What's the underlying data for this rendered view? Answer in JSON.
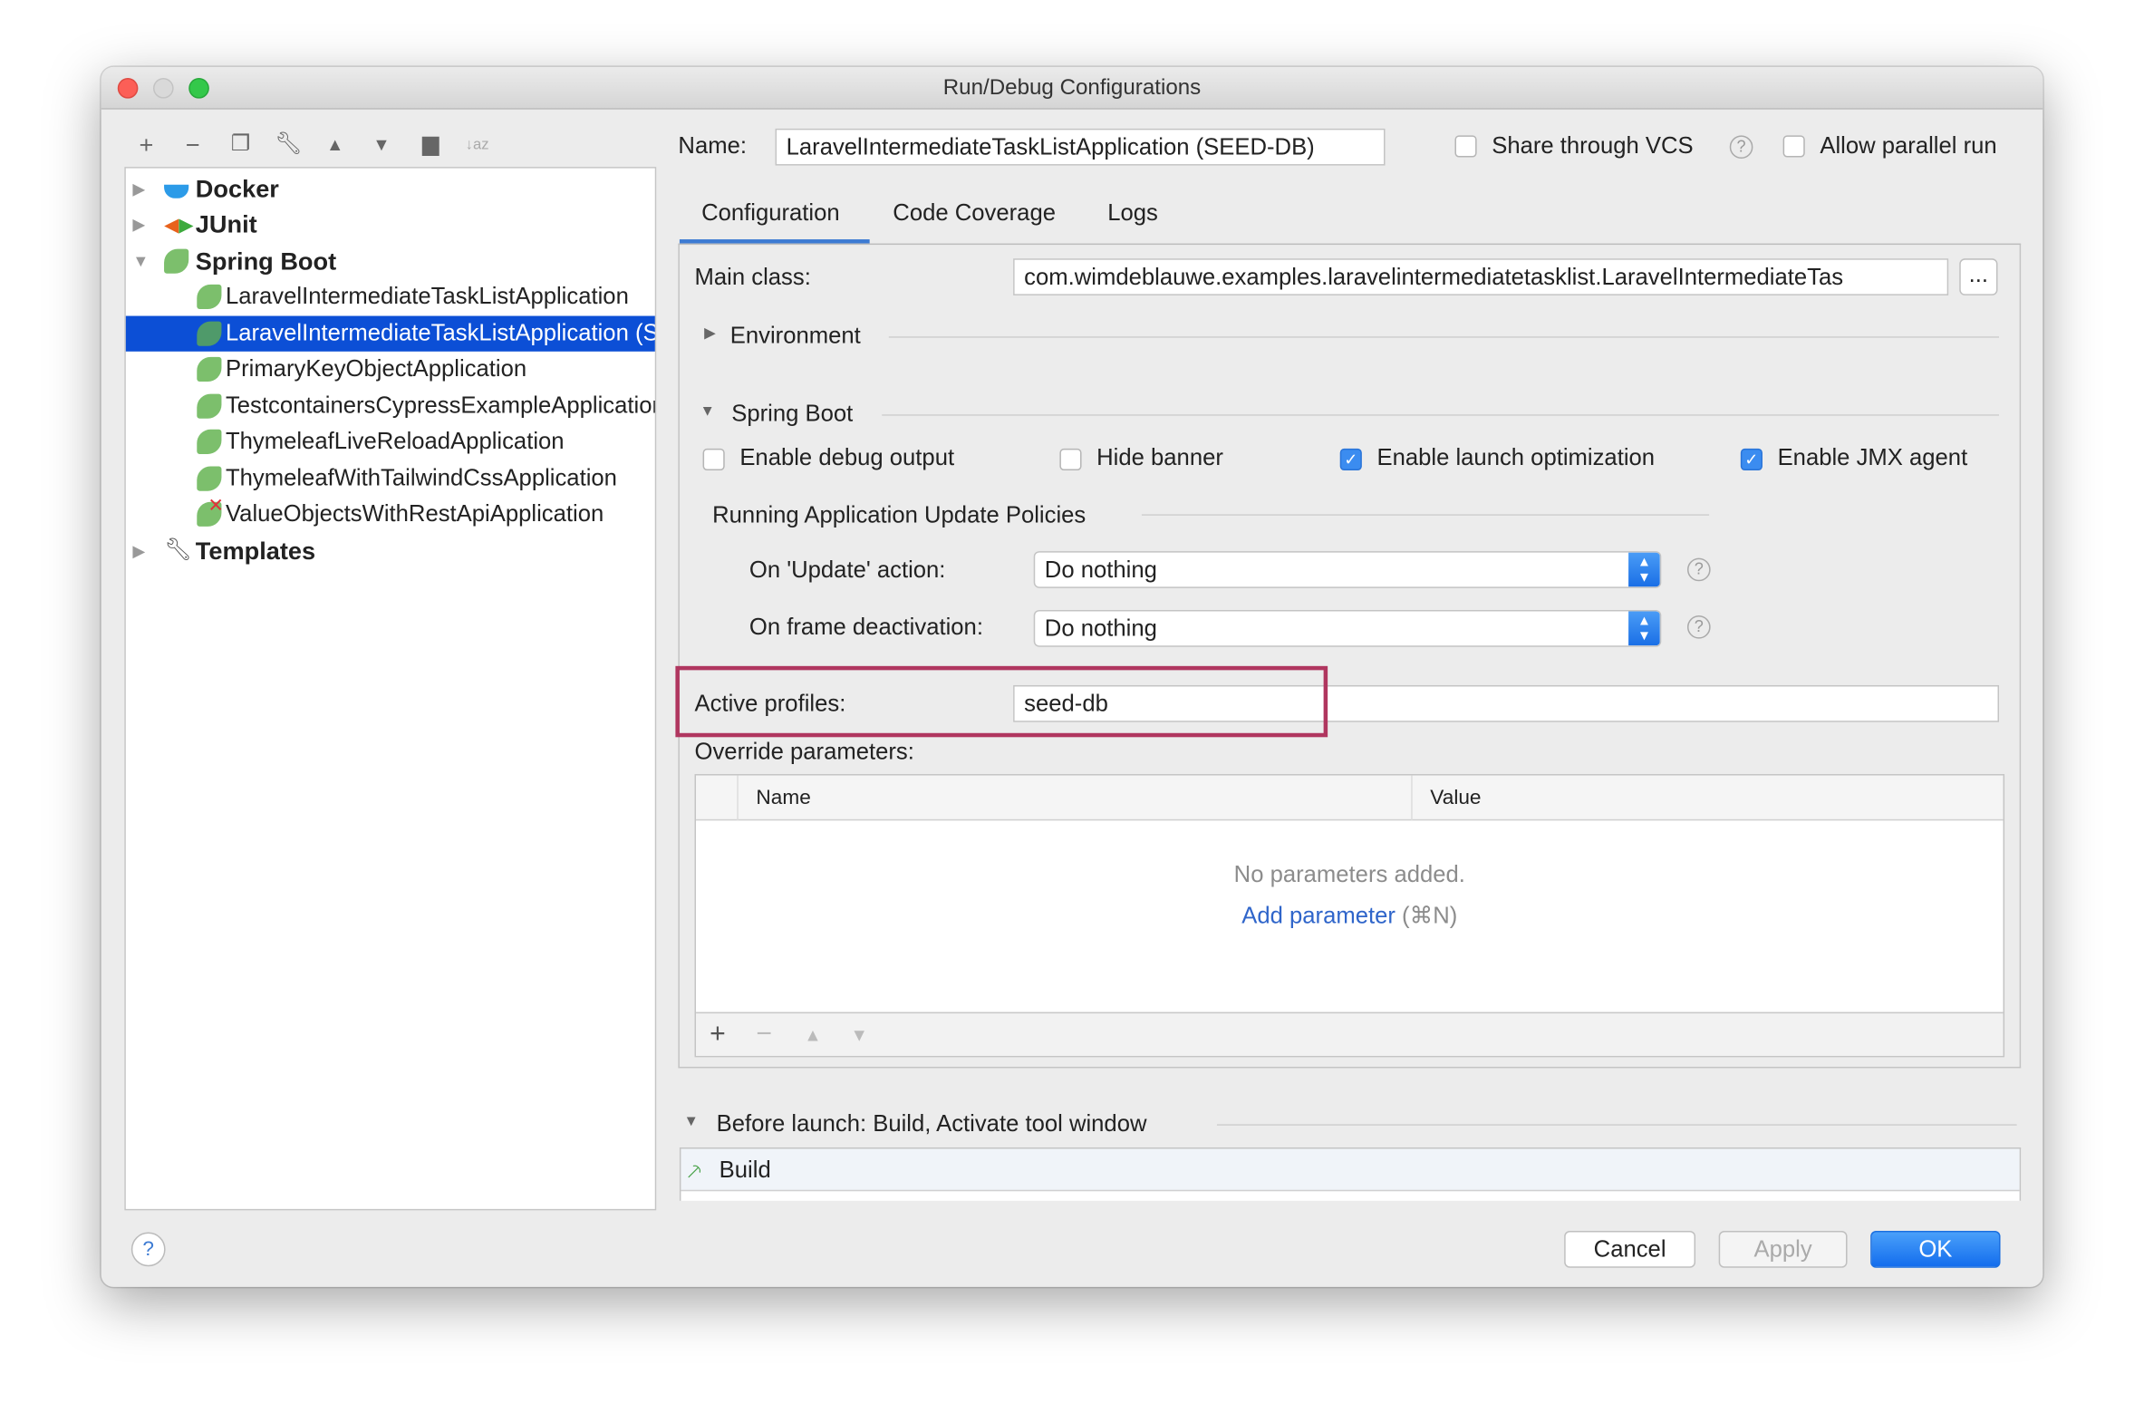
{
  "window": {
    "title": "Run/Debug Configurations"
  },
  "colors": {
    "selection": "#0c4fd6",
    "accent": "#3b8cf0",
    "highlight_box": "#b0365f",
    "link": "#2f65ca"
  },
  "toolbar": {
    "icons": [
      "plus-icon",
      "minus-icon",
      "copy-icon",
      "wrench-icon",
      "arrow-up-icon",
      "arrow-down-icon",
      "new-folder-icon",
      "sort-alpha-icon"
    ]
  },
  "tree": {
    "groups": {
      "docker": "Docker",
      "junit": "JUnit",
      "spring": "Spring Boot",
      "templates": "Templates"
    },
    "children": [
      "LaravelIntermediateTaskListApplication",
      "LaravelIntermediateTaskListApplication (SEED-DB)",
      "PrimaryKeyObjectApplication",
      "TestcontainersCypressExampleApplication",
      "ThymeleafLiveReloadApplication",
      "ThymeleafWithTailwindCssApplication",
      "ValueObjectsWithRestApiApplication"
    ]
  },
  "header": {
    "name_label": "Name:",
    "name_value": "LaravelIntermediateTaskListApplication (SEED-DB)",
    "share_vcs": "Share through VCS",
    "share_vcs_checked": false,
    "allow_parallel": "Allow parallel run",
    "allow_parallel_checked": false,
    "help": "?"
  },
  "tabs": [
    "Configuration",
    "Code Coverage",
    "Logs"
  ],
  "config": {
    "main_class_label": "Main class:",
    "main_class_value": "com.wimdeblauwe.examples.laravelintermediatetasklist.LaravelIntermediateTas",
    "browse": "...",
    "environment": "Environment",
    "spring_boot": "Spring Boot",
    "checks": [
      {
        "label": "Enable debug output",
        "checked": false
      },
      {
        "label": "Hide banner",
        "checked": false
      },
      {
        "label": "Enable launch optimization",
        "checked": true
      },
      {
        "label": "Enable JMX agent",
        "checked": true
      }
    ],
    "policies_title": "Running Application Update Policies",
    "update_label": "On 'Update' action:",
    "update_value": "Do nothing",
    "frame_label": "On frame deactivation:",
    "frame_value": "Do nothing",
    "profiles_label": "Active profiles:",
    "profiles_value": "seed-db",
    "override_label": "Override parameters:",
    "table_headers": [
      "Name",
      "Value"
    ],
    "empty_text": "No parameters added.",
    "add_link": "Add parameter",
    "add_shortcut": "(⌘N)"
  },
  "before_launch": {
    "title": "Before launch: Build, Activate tool window",
    "items": [
      "Build"
    ]
  },
  "footer": {
    "cancel": "Cancel",
    "apply": "Apply",
    "ok": "OK",
    "help": "?"
  }
}
